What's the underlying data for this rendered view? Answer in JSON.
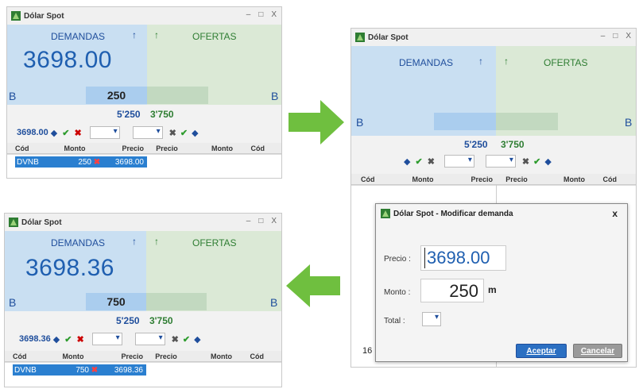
{
  "window_title": "Dólar Spot",
  "win_controls": [
    "–",
    "□",
    "X"
  ],
  "demandas_label": "DEMANDAS",
  "ofertas_label": "OFERTAS",
  "side_letter_left": "B",
  "side_letter_right": "B",
  "up_arrow": "↑",
  "total_demandas": "5'250",
  "total_ofertas": "3'750",
  "columns": [
    "Cód",
    "Monto",
    "Precio",
    "Precio",
    "Monto",
    "Cód"
  ],
  "panel_top_left": {
    "price": "3698.00",
    "quantity": "250",
    "control_price": "3698.00",
    "row": {
      "cod": "DVNB",
      "monto": "250",
      "precio": "3698.00"
    }
  },
  "panel_bottom_left": {
    "price": "3698.36",
    "quantity": "750",
    "control_price": "3698.36",
    "row": {
      "cod": "DVNB",
      "monto": "750",
      "precio": "3698.36"
    }
  },
  "dialog": {
    "title": "Dólar Spot - Modificar demanda",
    "close": "x",
    "precio_label": "Precio :",
    "precio_value": "3698.00",
    "monto_label": "Monto :",
    "monto_value": "250",
    "monto_unit": "m",
    "total_label": "Total :",
    "accept": "Aceptar",
    "cancel": "Cancelar",
    "behind_text": "16"
  },
  "colors": {
    "demand_bg": "#c9dff2",
    "offer_bg": "#dbe9d6",
    "accent_blue": "#1f5fb0",
    "arrow_green": "#6fbf3f",
    "selected_row": "#2a7fd0"
  }
}
